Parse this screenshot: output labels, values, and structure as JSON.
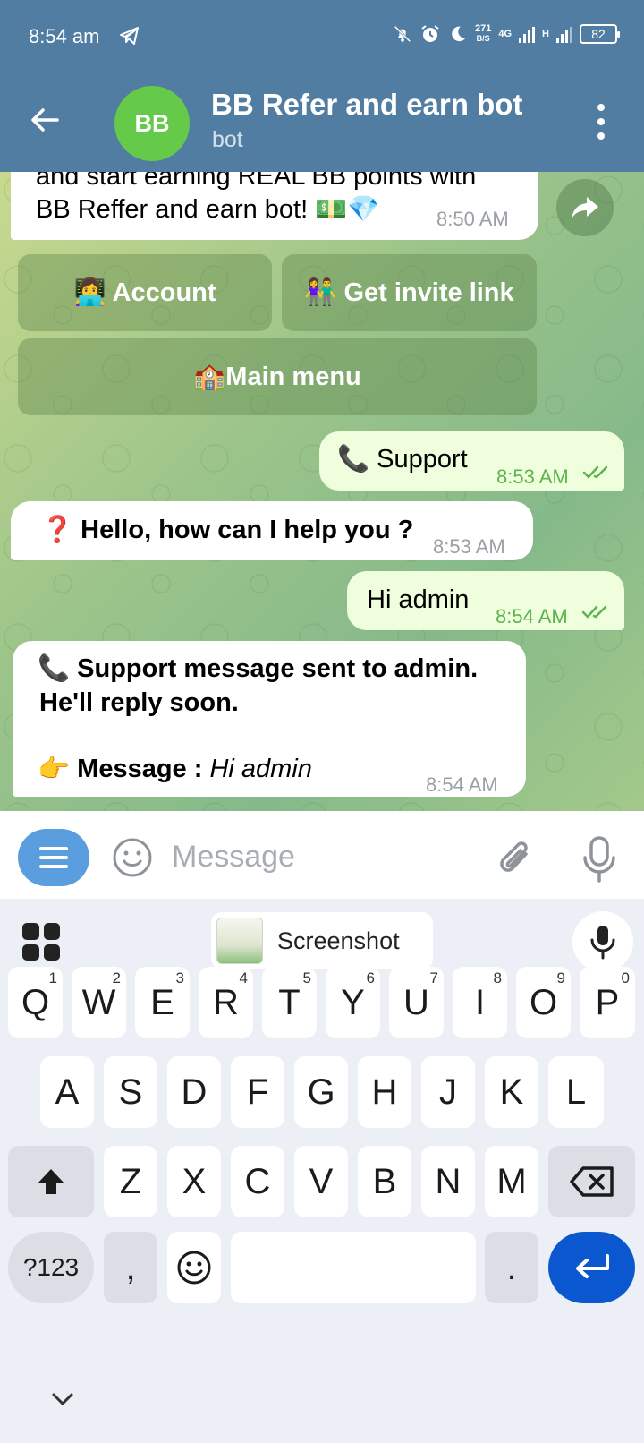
{
  "status_bar": {
    "time": "8:54 am",
    "speed_value": "271",
    "speed_unit": "B/S",
    "network": "4G",
    "network2": "H",
    "battery": "82"
  },
  "header": {
    "avatar_initials": "BB",
    "title": "BB Refer and earn bot",
    "subtitle": "bot",
    "accent_color": "#517da2"
  },
  "messages": [
    {
      "direction": "in",
      "lines": [
        "and start earning REAL BB points with",
        "BB Reffer and earn bot! 💵💎"
      ],
      "time": "8:50 AM"
    },
    {
      "direction": "out",
      "text": "📞 Support",
      "time": "8:53 AM",
      "read": true
    },
    {
      "direction": "in",
      "text": "❓ Hello, how can I help you ?",
      "time": "8:53 AM"
    },
    {
      "direction": "out",
      "text": "Hi admin",
      "time": "8:54 AM",
      "read": true
    },
    {
      "direction": "in",
      "lines": [
        "📞 Support message sent to admin.",
        "He'll reply soon."
      ],
      "message_label": "👉 Message :",
      "message_value": "Hi admin",
      "time": "8:54 AM"
    }
  ],
  "inline_keyboard": [
    {
      "label": "👩‍💻 Account"
    },
    {
      "label": "👫 Get invite link"
    },
    {
      "label": "🏫Main menu"
    }
  ],
  "input": {
    "placeholder": "Message",
    "value": ""
  },
  "keyboard": {
    "suggestion_chip": "Screenshot",
    "row1": [
      {
        "key": "Q",
        "hint": "1"
      },
      {
        "key": "W",
        "hint": "2"
      },
      {
        "key": "E",
        "hint": "3"
      },
      {
        "key": "R",
        "hint": "4"
      },
      {
        "key": "T",
        "hint": "5"
      },
      {
        "key": "Y",
        "hint": "6"
      },
      {
        "key": "U",
        "hint": "7"
      },
      {
        "key": "I",
        "hint": "8"
      },
      {
        "key": "O",
        "hint": "9"
      },
      {
        "key": "P",
        "hint": "0"
      }
    ],
    "row2": [
      "A",
      "S",
      "D",
      "F",
      "G",
      "H",
      "J",
      "K",
      "L"
    ],
    "row3": [
      "Z",
      "X",
      "C",
      "V",
      "B",
      "N",
      "M"
    ],
    "symbols_key": "?123",
    "comma_key": ",",
    "period_key": ".",
    "enter_color": "#0b57d0"
  }
}
